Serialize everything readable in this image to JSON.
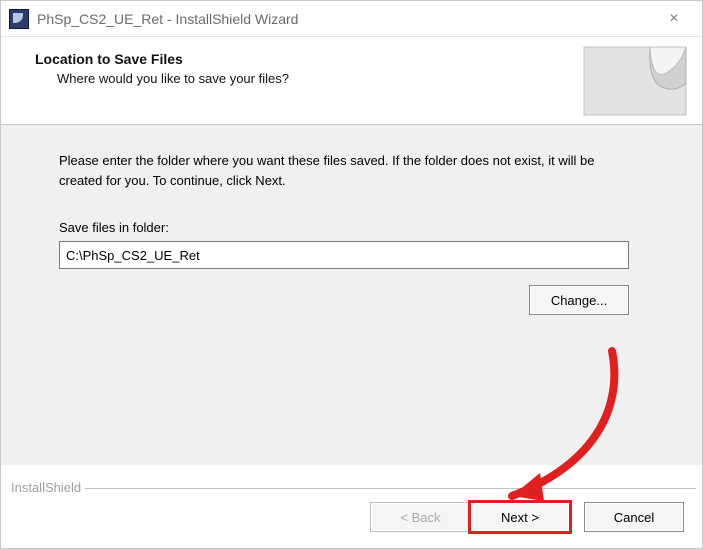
{
  "titlebar": {
    "title": "PhSp_CS2_UE_Ret - InstallShield Wizard",
    "close_symbol": "×"
  },
  "header": {
    "heading": "Location to Save Files",
    "subheading": "Where would you like to save your files?"
  },
  "body": {
    "instructions": "Please enter the folder where you want these files saved.  If the folder does not exist, it will be created for you.   To continue, click Next.",
    "field_label": "Save files in folder:",
    "folder_value": "C:\\PhSp_CS2_UE_Ret",
    "change_label": "Change..."
  },
  "footer": {
    "brand": "InstallShield",
    "back_label": "< Back",
    "next_label": "Next >",
    "cancel_label": "Cancel"
  }
}
